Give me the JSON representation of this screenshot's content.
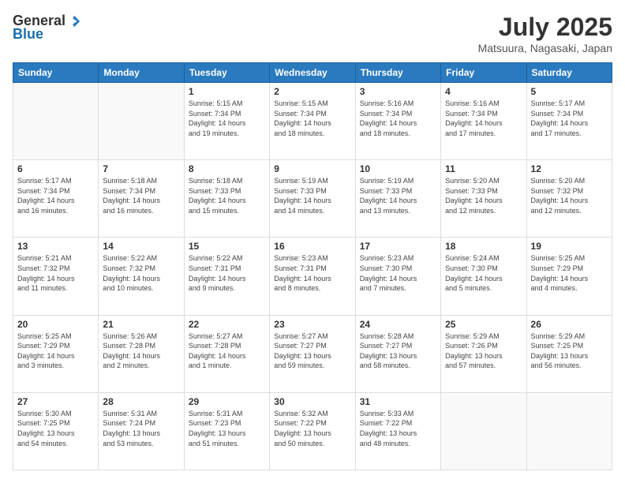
{
  "header": {
    "logo_general": "General",
    "logo_blue": "Blue",
    "month": "July 2025",
    "location": "Matsuura, Nagasaki, Japan"
  },
  "days_of_week": [
    "Sunday",
    "Monday",
    "Tuesday",
    "Wednesday",
    "Thursday",
    "Friday",
    "Saturday"
  ],
  "weeks": [
    [
      {
        "day": "",
        "info": ""
      },
      {
        "day": "",
        "info": ""
      },
      {
        "day": "1",
        "info": "Sunrise: 5:15 AM\nSunset: 7:34 PM\nDaylight: 14 hours\nand 19 minutes."
      },
      {
        "day": "2",
        "info": "Sunrise: 5:15 AM\nSunset: 7:34 PM\nDaylight: 14 hours\nand 18 minutes."
      },
      {
        "day": "3",
        "info": "Sunrise: 5:16 AM\nSunset: 7:34 PM\nDaylight: 14 hours\nand 18 minutes."
      },
      {
        "day": "4",
        "info": "Sunrise: 5:16 AM\nSunset: 7:34 PM\nDaylight: 14 hours\nand 17 minutes."
      },
      {
        "day": "5",
        "info": "Sunrise: 5:17 AM\nSunset: 7:34 PM\nDaylight: 14 hours\nand 17 minutes."
      }
    ],
    [
      {
        "day": "6",
        "info": "Sunrise: 5:17 AM\nSunset: 7:34 PM\nDaylight: 14 hours\nand 16 minutes."
      },
      {
        "day": "7",
        "info": "Sunrise: 5:18 AM\nSunset: 7:34 PM\nDaylight: 14 hours\nand 16 minutes."
      },
      {
        "day": "8",
        "info": "Sunrise: 5:18 AM\nSunset: 7:33 PM\nDaylight: 14 hours\nand 15 minutes."
      },
      {
        "day": "9",
        "info": "Sunrise: 5:19 AM\nSunset: 7:33 PM\nDaylight: 14 hours\nand 14 minutes."
      },
      {
        "day": "10",
        "info": "Sunrise: 5:19 AM\nSunset: 7:33 PM\nDaylight: 14 hours\nand 13 minutes."
      },
      {
        "day": "11",
        "info": "Sunrise: 5:20 AM\nSunset: 7:33 PM\nDaylight: 14 hours\nand 12 minutes."
      },
      {
        "day": "12",
        "info": "Sunrise: 5:20 AM\nSunset: 7:32 PM\nDaylight: 14 hours\nand 12 minutes."
      }
    ],
    [
      {
        "day": "13",
        "info": "Sunrise: 5:21 AM\nSunset: 7:32 PM\nDaylight: 14 hours\nand 11 minutes."
      },
      {
        "day": "14",
        "info": "Sunrise: 5:22 AM\nSunset: 7:32 PM\nDaylight: 14 hours\nand 10 minutes."
      },
      {
        "day": "15",
        "info": "Sunrise: 5:22 AM\nSunset: 7:31 PM\nDaylight: 14 hours\nand 9 minutes."
      },
      {
        "day": "16",
        "info": "Sunrise: 5:23 AM\nSunset: 7:31 PM\nDaylight: 14 hours\nand 8 minutes."
      },
      {
        "day": "17",
        "info": "Sunrise: 5:23 AM\nSunset: 7:30 PM\nDaylight: 14 hours\nand 7 minutes."
      },
      {
        "day": "18",
        "info": "Sunrise: 5:24 AM\nSunset: 7:30 PM\nDaylight: 14 hours\nand 5 minutes."
      },
      {
        "day": "19",
        "info": "Sunrise: 5:25 AM\nSunset: 7:29 PM\nDaylight: 14 hours\nand 4 minutes."
      }
    ],
    [
      {
        "day": "20",
        "info": "Sunrise: 5:25 AM\nSunset: 7:29 PM\nDaylight: 14 hours\nand 3 minutes."
      },
      {
        "day": "21",
        "info": "Sunrise: 5:26 AM\nSunset: 7:28 PM\nDaylight: 14 hours\nand 2 minutes."
      },
      {
        "day": "22",
        "info": "Sunrise: 5:27 AM\nSunset: 7:28 PM\nDaylight: 14 hours\nand 1 minute."
      },
      {
        "day": "23",
        "info": "Sunrise: 5:27 AM\nSunset: 7:27 PM\nDaylight: 13 hours\nand 59 minutes."
      },
      {
        "day": "24",
        "info": "Sunrise: 5:28 AM\nSunset: 7:27 PM\nDaylight: 13 hours\nand 58 minutes."
      },
      {
        "day": "25",
        "info": "Sunrise: 5:29 AM\nSunset: 7:26 PM\nDaylight: 13 hours\nand 57 minutes."
      },
      {
        "day": "26",
        "info": "Sunrise: 5:29 AM\nSunset: 7:25 PM\nDaylight: 13 hours\nand 56 minutes."
      }
    ],
    [
      {
        "day": "27",
        "info": "Sunrise: 5:30 AM\nSunset: 7:25 PM\nDaylight: 13 hours\nand 54 minutes."
      },
      {
        "day": "28",
        "info": "Sunrise: 5:31 AM\nSunset: 7:24 PM\nDaylight: 13 hours\nand 53 minutes."
      },
      {
        "day": "29",
        "info": "Sunrise: 5:31 AM\nSunset: 7:23 PM\nDaylight: 13 hours\nand 51 minutes."
      },
      {
        "day": "30",
        "info": "Sunrise: 5:32 AM\nSunset: 7:22 PM\nDaylight: 13 hours\nand 50 minutes."
      },
      {
        "day": "31",
        "info": "Sunrise: 5:33 AM\nSunset: 7:22 PM\nDaylight: 13 hours\nand 48 minutes."
      },
      {
        "day": "",
        "info": ""
      },
      {
        "day": "",
        "info": ""
      }
    ]
  ]
}
